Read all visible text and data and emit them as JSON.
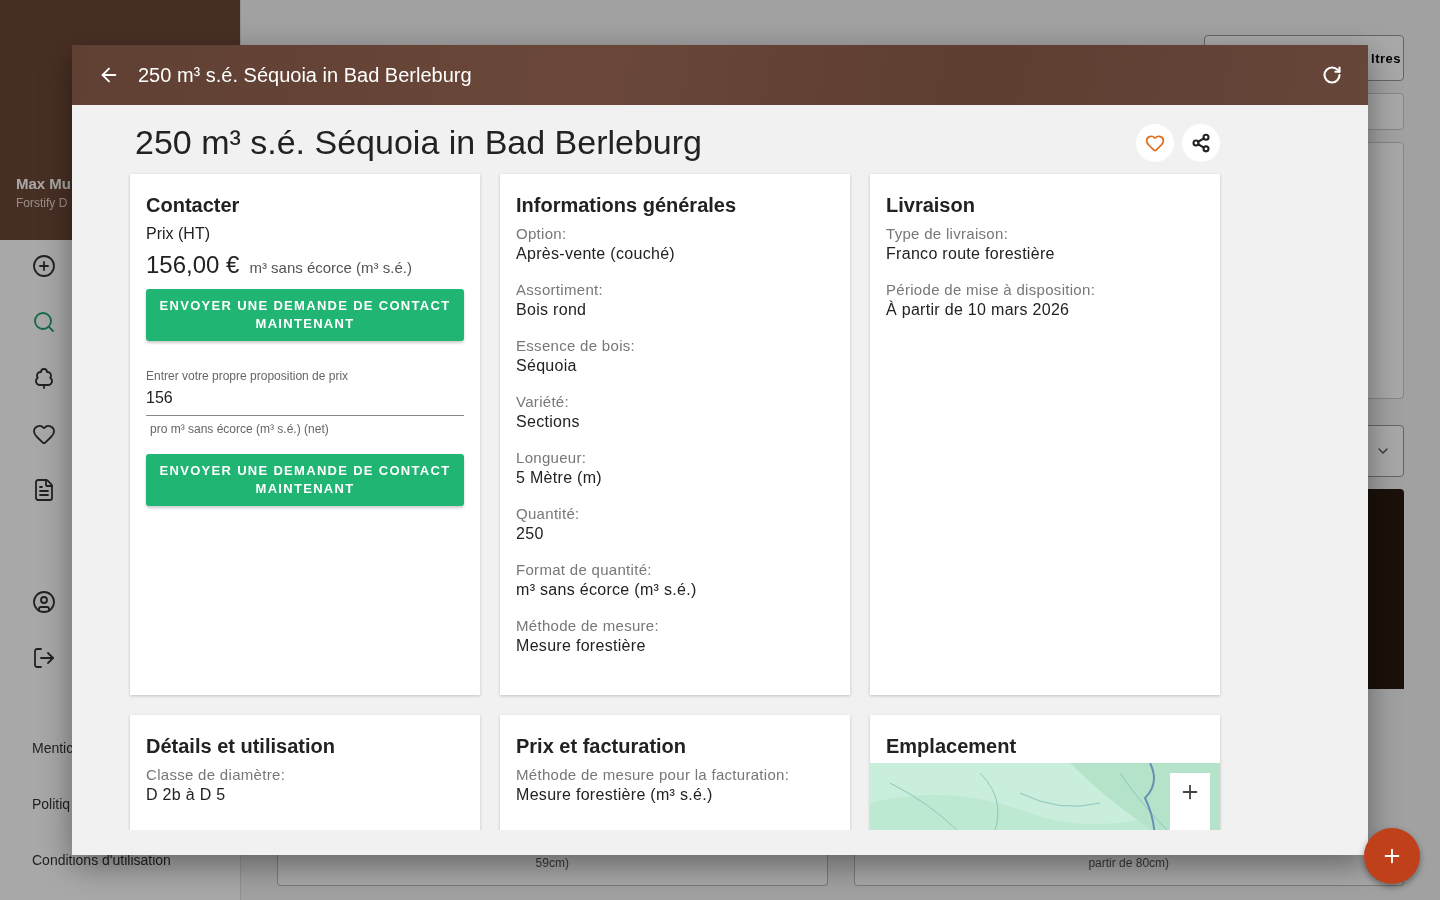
{
  "sidebar": {
    "user_name": "Max Mu",
    "company": "Forstify D",
    "nav_items": [
      {
        "selected": false
      },
      {
        "selected": true
      },
      {
        "selected": false
      },
      {
        "selected": false
      },
      {
        "selected": false
      },
      {
        "selected": false
      },
      {
        "selected": false
      }
    ],
    "footer_links": [
      "Mentic",
      "Politiq",
      "Conditions d'utilisation"
    ]
  },
  "background": {
    "filter_button": "ltres",
    "listing_cards": [
      "59cm)",
      "partir de 80cm)"
    ]
  },
  "modal": {
    "title": "250 m³ s.é. Séquoia in Bad Berleburg",
    "heading": "250 m³ s.é. Séquoia in Bad Berleburg",
    "contact_card": {
      "title": "Contacter",
      "price_label": "Prix (HT)",
      "price": "156,00 €",
      "unit": "m³ sans écorce (m³ s.é.)",
      "button": "ENVOYER UNE DEMANDE DE CONTACT MAINTENANT",
      "field_label": "Entrer votre propre proposition de prix",
      "field_value": "156",
      "field_helper": "pro m³ sans écorce (m³ s.é.) (net)",
      "button_2": "ENVOYER UNE DEMANDE DE CONTACT MAINTENANT"
    },
    "info_cards": [
      {
        "title": "Informations générales",
        "fields": [
          {
            "label": "Option:",
            "value": "Après-vente (couché)"
          },
          {
            "label": "Assortiment:",
            "value": "Bois rond"
          },
          {
            "label": "Essence de bois:",
            "value": "Séquoia"
          },
          {
            "label": "Variété:",
            "value": "Sections"
          },
          {
            "label": "Longueur:",
            "value": "5 Mètre (m)"
          },
          {
            "label": "Quantité:",
            "value": "250"
          },
          {
            "label": "Format de quantité:",
            "value": "m³ sans écorce (m³ s.é.)"
          },
          {
            "label": "Méthode de mesure:",
            "value": "Mesure forestière"
          }
        ]
      },
      {
        "title": "Livraison",
        "fields": [
          {
            "label": "Type de livraison:",
            "value": "Franco route forestière"
          },
          {
            "label": "Période de mise à disposition:",
            "value": "À partir de 10 mars 2026"
          }
        ]
      }
    ],
    "lower_cards": [
      {
        "kind": "fields",
        "title": "Détails et utilisation",
        "fields": [
          {
            "label": "Classe de diamètre:",
            "value": "D 2b à D 5"
          }
        ]
      },
      {
        "kind": "fields",
        "title": "Prix et facturation",
        "fields": [
          {
            "label": "Méthode de mesure pour la facturation:",
            "value": "Mesure forestière (m³ s.é.)"
          }
        ]
      },
      {
        "kind": "map",
        "title": "Emplacement"
      }
    ]
  }
}
